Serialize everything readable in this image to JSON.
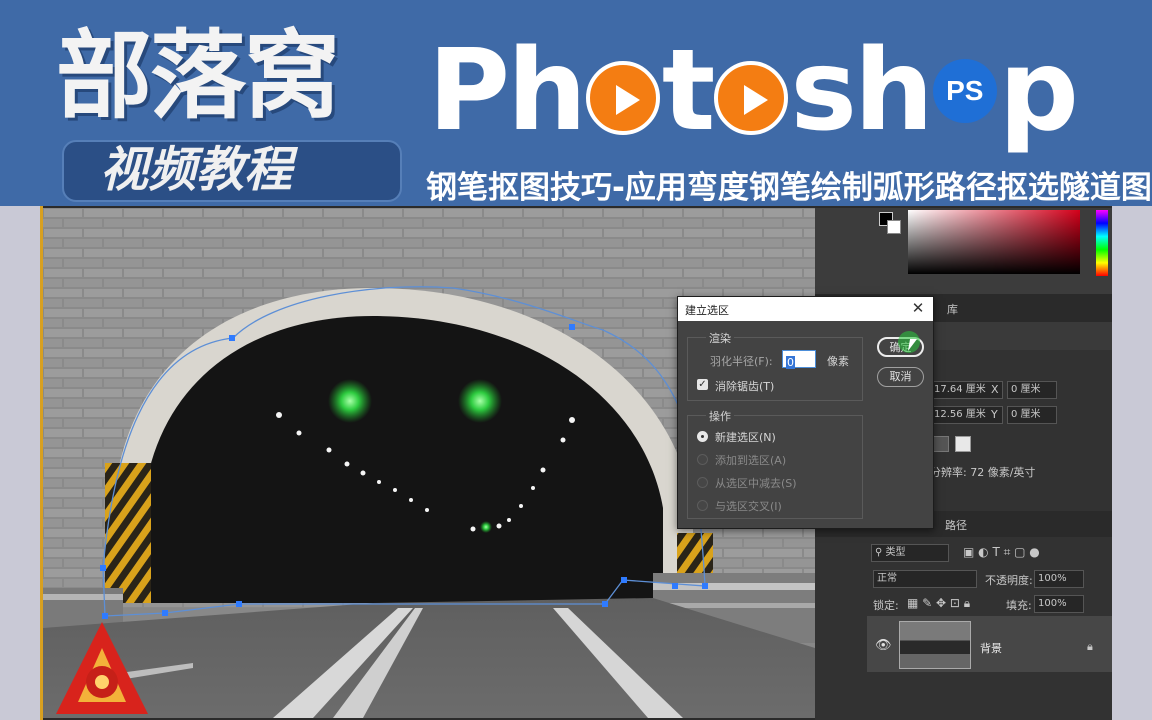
{
  "banner": {
    "brand": "部落窝",
    "video_tutorial": "视频教程",
    "app_title_letters": [
      "P",
      "h",
      "t",
      "s",
      "h",
      "p"
    ],
    "ps_badge": "PS",
    "subtitle": "钢笔抠图技巧-应用弯度钢笔绘制弧形路径抠选隧道图片"
  },
  "dialog": {
    "title": "建立选区",
    "render_group": "渲染",
    "feather_label": "羽化半径(F):",
    "feather_value": "0",
    "feather_unit": "像素",
    "antialias_label": "消除锯齿(T)",
    "antialias_checked": true,
    "operation_group": "操作",
    "ops": [
      {
        "label": "新建选区(N)",
        "selected": true,
        "enabled": true
      },
      {
        "label": "添加到选区(A)",
        "selected": false,
        "enabled": false
      },
      {
        "label": "从选区中减去(S)",
        "selected": false,
        "enabled": false
      },
      {
        "label": "与选区交叉(I)",
        "selected": false,
        "enabled": false
      }
    ],
    "ok_label": "确定",
    "cancel_label": "取消"
  },
  "panel": {
    "library_tab": "库",
    "width_value": "17.64 厘米",
    "height_value": "12.56 厘米",
    "x_label": "X",
    "x_value": "0 厘米",
    "y_label": "Y",
    "y_value": "0 厘米",
    "resolution": "分辨率: 72 像素/英寸",
    "paths_tab": "路径",
    "filter_kind": "类型",
    "blend_mode": "正常",
    "opacity_label": "不透明度:",
    "opacity_value": "100%",
    "lock_label": "锁定:",
    "fill_label": "填充:",
    "fill_value": "100%",
    "layer_name": "背景"
  },
  "colors": {
    "banner_bg": "#3f6aa7",
    "ps_orange": "#f47d12",
    "ps_blue": "#1f6fd6",
    "panel_bg": "#323232",
    "dialog_bg": "#434343",
    "path_stroke": "#5d8fd6",
    "anchor": "#2f7bff"
  }
}
